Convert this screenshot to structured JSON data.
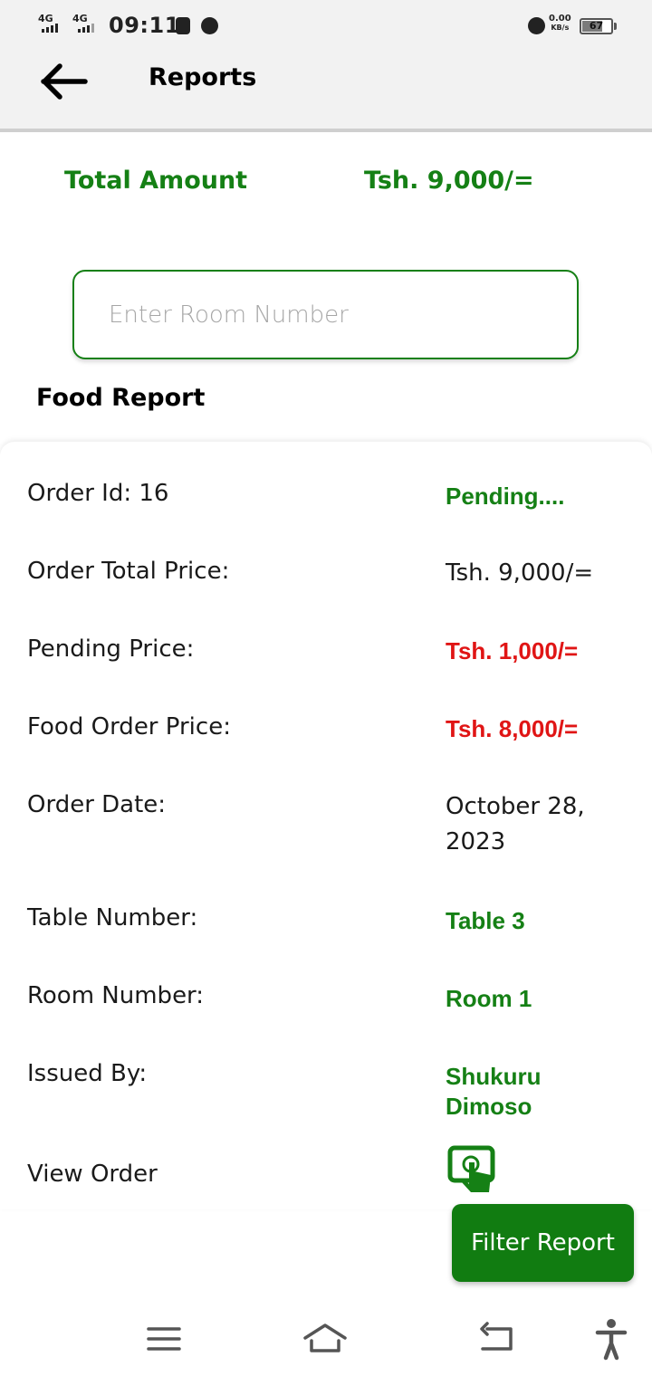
{
  "status_bar": {
    "network_1": "4G",
    "network_2": "4G",
    "time": "09:11",
    "speed_value": "0.00",
    "speed_unit": "KB/s",
    "battery": "67"
  },
  "app_bar": {
    "title": "Reports",
    "back_icon": "arrow-left-icon"
  },
  "summary": {
    "label": "Total Amount",
    "value": "Tsh. 9,000/="
  },
  "search": {
    "placeholder": "Enter Room Number",
    "value": ""
  },
  "section_title": "Food Report",
  "report": {
    "order_id_label": "Order Id: 16",
    "status": "Pending....",
    "total_price_label": "Order Total Price:",
    "total_price_value": "Tsh. 9,000/=",
    "pending_price_label": "Pending Price:",
    "pending_price_value": "Tsh. 1,000/=",
    "food_price_label": "Food Order Price:",
    "food_price_value": "Tsh. 8,000/=",
    "order_date_label": "Order Date:",
    "order_date_value": "October 28, 2023",
    "table_label": "Table Number:",
    "table_value": "Table 3",
    "room_label": "Room Number:",
    "room_value": "Room 1",
    "issued_label": "Issued By:",
    "issued_value": "Shukuru Dimoso",
    "view_order_label": "View Order",
    "view_order_icon": "touch-screen-icon"
  },
  "filter_button": "Filter Report",
  "nav": [
    "menu-icon",
    "home-icon",
    "back-icon",
    "accessibility-icon"
  ],
  "colors": {
    "green": "#158015",
    "red": "#e01515",
    "button_green": "#117c11"
  }
}
